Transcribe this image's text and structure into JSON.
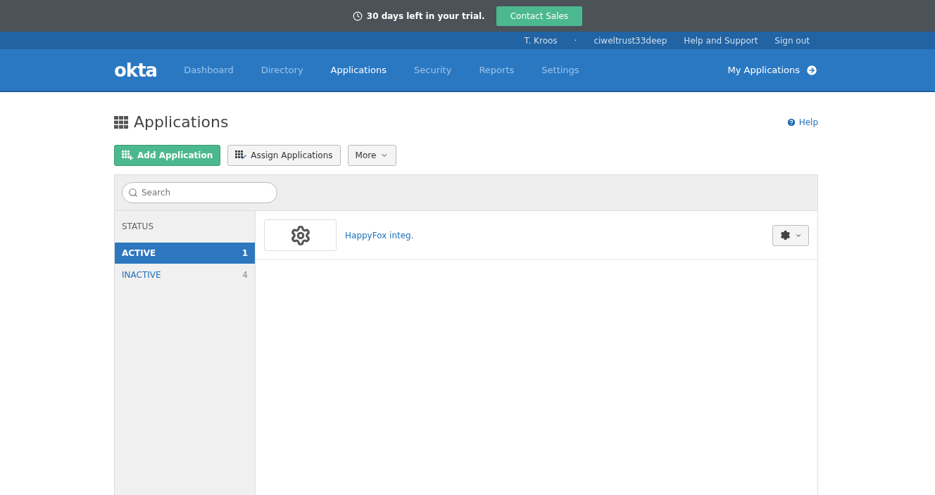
{
  "trial_banner": {
    "message": "30 days left in your trial.",
    "button": "Contact Sales"
  },
  "user_bar": {
    "user": "T. Kroos",
    "separator": "·",
    "org": "ciweltrust33deep",
    "links": [
      "Help and Support",
      "Sign out"
    ]
  },
  "nav": {
    "logo": "okta",
    "items": [
      {
        "label": "Dashboard",
        "selected": false
      },
      {
        "label": "Directory",
        "selected": false
      },
      {
        "label": "Applications",
        "selected": true
      },
      {
        "label": "Security",
        "selected": false
      },
      {
        "label": "Reports",
        "selected": false
      },
      {
        "label": "Settings",
        "selected": false
      }
    ],
    "my_applications": "My Applications"
  },
  "page": {
    "title": "Applications",
    "help": "Help"
  },
  "toolbar": {
    "add": "Add Application",
    "assign": "Assign Applications",
    "more": "More"
  },
  "search": {
    "placeholder": "Search"
  },
  "sidebar": {
    "heading": "STATUS",
    "items": [
      {
        "label": "ACTIVE",
        "count": "1",
        "selected": true
      },
      {
        "label": "INACTIVE",
        "count": "4",
        "selected": false
      }
    ]
  },
  "apps": [
    {
      "name": "HappyFox integ."
    }
  ]
}
